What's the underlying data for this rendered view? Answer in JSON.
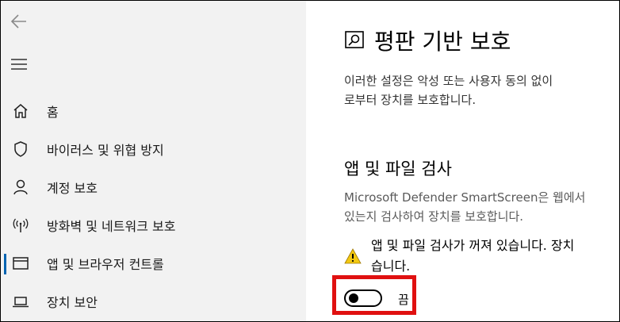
{
  "sidebar": {
    "items": [
      {
        "label": "홈",
        "icon": "home-icon"
      },
      {
        "label": "바이러스 및 위협 방지",
        "icon": "shield-icon"
      },
      {
        "label": "계정 보호",
        "icon": "person-icon"
      },
      {
        "label": "방화벽 및 네트워크 보호",
        "icon": "wireless-icon"
      },
      {
        "label": "앱 및 브라우저 컨트롤",
        "icon": "browser-window-icon",
        "active": true
      },
      {
        "label": "장치 보안",
        "icon": "laptop-icon"
      }
    ]
  },
  "main": {
    "title": "평판 기반 보호",
    "description_lines": [
      "이러한 설정은 악성 또는 사용자 동의 없이",
      "로부터 장치를 보호합니다."
    ],
    "section": {
      "title": "앱 및 파일 검사",
      "description_lines": [
        "Microsoft Defender SmartScreen은 웹에서",
        "있는지 검사하여 장치를 보호합니다."
      ],
      "warning_lines": [
        "앱 및 파일 검사가 꺼져 있습니다. 장치",
        "습니다."
      ],
      "toggle": {
        "state_label": "끔",
        "on": false
      }
    }
  },
  "colors": {
    "sidebar_bg": "#f2f2f2",
    "accent": "#0063b1",
    "highlight_border": "#e01010",
    "warning": "#f2c811"
  }
}
